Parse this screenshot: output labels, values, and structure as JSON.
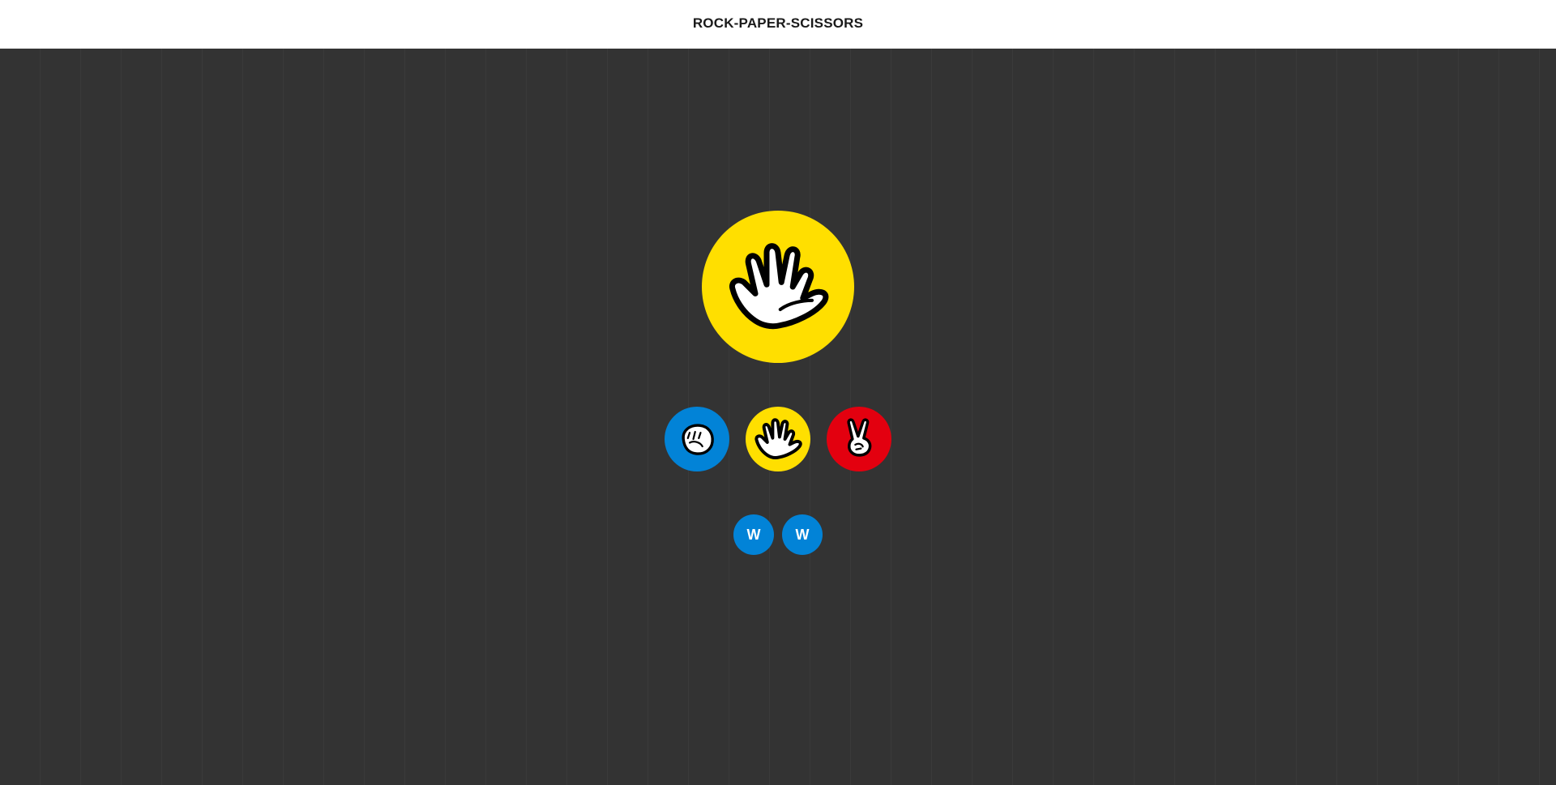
{
  "header": {
    "title": "ROCK-PAPER-SCISSORS"
  },
  "result": {
    "icon": "paper-hand-icon",
    "color": "#ffdf00"
  },
  "choices": [
    {
      "name": "rock",
      "icon": "rock-fist-icon",
      "color": "#0283d7"
    },
    {
      "name": "paper",
      "icon": "paper-hand-icon",
      "color": "#ffdf00"
    },
    {
      "name": "scissors",
      "icon": "scissors-hand-icon",
      "color": "#e3000f"
    }
  ],
  "history": [
    {
      "label": "W",
      "color": "#0283d7"
    },
    {
      "label": "W",
      "color": "#0283d7"
    }
  ],
  "colors": {
    "background": "#333333",
    "header": "#ffffff",
    "header_shadow": "#cfcfcf"
  }
}
